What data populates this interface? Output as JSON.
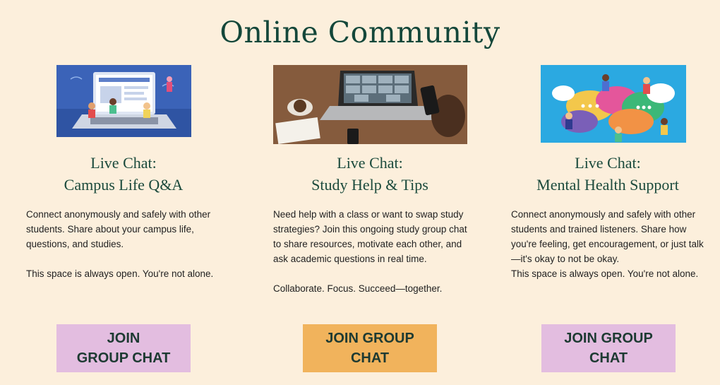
{
  "page": {
    "title": "Online Community",
    "colors": {
      "background": "#fcefdc",
      "heading": "#14473a",
      "button_pink": "#e3bde0",
      "button_orange": "#f1b35c"
    }
  },
  "cards": [
    {
      "image": "campus-laptop-illustration",
      "title_line1": "Live Chat:",
      "title_line2": "Campus Life Q&A",
      "paragraph1": "Connect anonymously and safely with other students. Share about your campus life, questions, and studies.",
      "paragraph2": "This space is always open. You're not alone.",
      "button_line1": "JOIN",
      "button_line2": "GROUP CHAT",
      "button_color": "#e3bde0"
    },
    {
      "image": "video-call-photo",
      "title_line1": "Live Chat:",
      "title_line2": "Study Help & Tips",
      "paragraph1": "Need help with a class or want to swap study strategies? Join this ongoing study group chat to share resources, motivate each other, and ask academic questions in real time.",
      "paragraph2": "Collaborate. Focus. Succeed—together.",
      "button_line1": "JOIN GROUP",
      "button_line2": "CHAT",
      "button_color": "#f1b35c"
    },
    {
      "image": "people-speech-bubbles-illustration",
      "title_line1": "Live Chat:",
      "title_line2": "Mental Health Support",
      "paragraph1": "Connect anonymously and safely with other students and trained listeners. Share how you're feeling, get encouragement, or just talk—it's okay to not be okay.",
      "paragraph2": "This space is always open. You're not alone.",
      "button_line1": "JOIN GROUP",
      "button_line2": "CHAT",
      "button_color": "#e3bde0"
    }
  ]
}
